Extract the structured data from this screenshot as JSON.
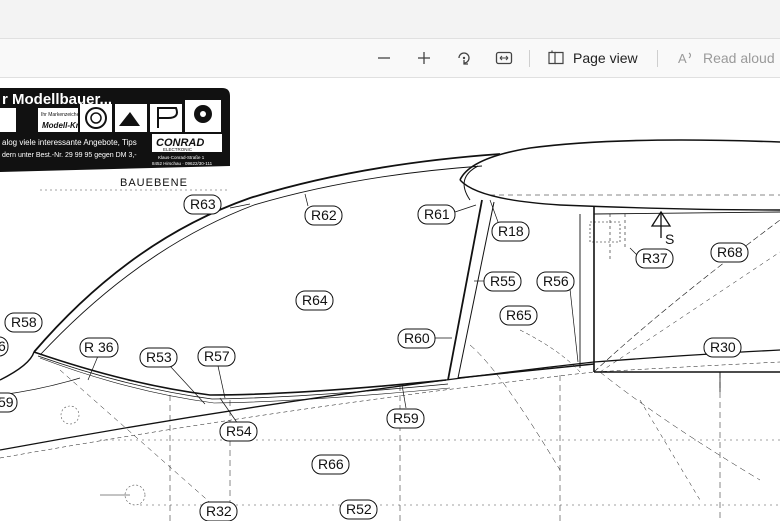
{
  "toolbar": {
    "zoom_out_icon": "minus-icon",
    "zoom_in_icon": "plus-icon",
    "rotate_icon": "rotate-icon",
    "fit_icon": "fit-width-icon",
    "page_view_label": "Page view",
    "read_aloud_label": "Read aloud"
  },
  "document": {
    "stamp": {
      "headline": "r Modellbauer...",
      "sub1": "Ihr Markenzeichen für",
      "brand": "Modell-Kraft",
      "catalog_line1": "alog viele interessante Angebote, Tips",
      "catalog_line2": "dern unter Best.-Nr. 29 99 95 gegen DM 3,-",
      "company": "CONRAD",
      "company_sub": "ELECTRONIC",
      "address1": "Klaus-Conrad-Straße 1",
      "address2": "8452 Hirschau · 09622/30-111"
    },
    "bauebene": "BAUEBENE",
    "s_marker": "S",
    "labels": {
      "r63": "R63",
      "r62": "R62",
      "r61": "R61",
      "r18": "R18",
      "r55": "R55",
      "r56": "R56",
      "r37": "R37",
      "r68": "R68",
      "r64": "R64",
      "r65": "R65",
      "r58": "R58",
      "r60": "R60",
      "r30": "R30",
      "r36": "R 36",
      "r53": "R53",
      "r57": "R57",
      "r54": "R54",
      "r59": "R59",
      "r66": "R66",
      "r32": "R32",
      "r52": "R52",
      "r5x": "6",
      "r69": "59"
    }
  }
}
